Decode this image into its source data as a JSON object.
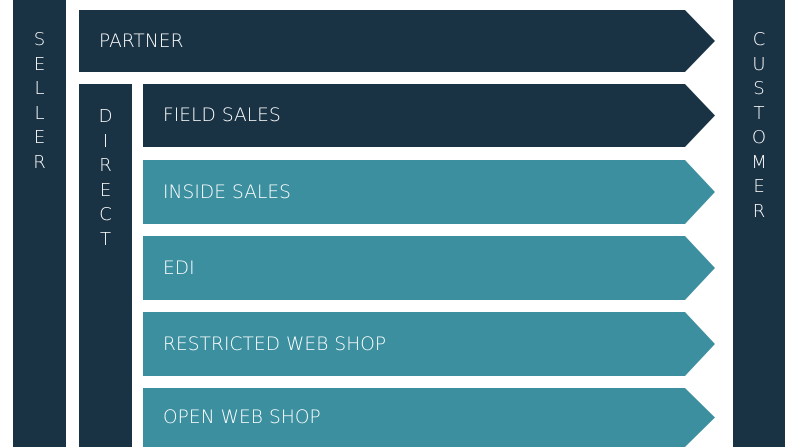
{
  "colors": {
    "dark": "#1a3344",
    "teal": "#3b8f9f",
    "text": "#ffffff"
  },
  "seller_label": "SELLER",
  "customer_label": "CUSTOMER",
  "direct_label": "DIRECT",
  "channels": {
    "partner": "PARTNER",
    "field_sales": "FIELD SALES",
    "inside_sales": "INSIDE SALES",
    "edi": "EDI",
    "restricted_web_shop": "RESTRICTED WEB SHOP",
    "open_web_shop": "OPEN WEB SHOP"
  }
}
